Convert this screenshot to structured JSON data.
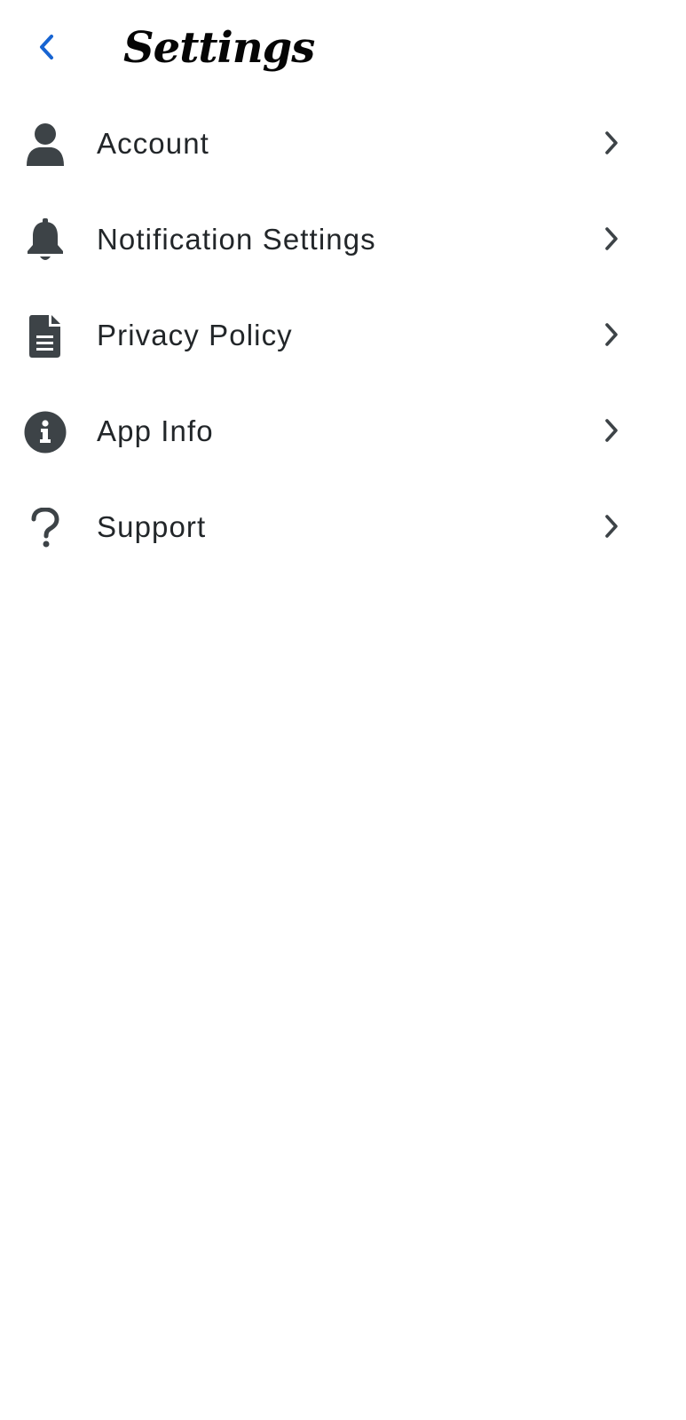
{
  "header": {
    "title": "Settings",
    "back_icon": "chevron-left-icon"
  },
  "settings": {
    "items": [
      {
        "label": "Account",
        "icon": "person-icon"
      },
      {
        "label": "Notification Settings",
        "icon": "bell-icon"
      },
      {
        "label": "Privacy Policy",
        "icon": "document-icon"
      },
      {
        "label": "App Info",
        "icon": "info-icon"
      },
      {
        "label": "Support",
        "icon": "question-icon"
      }
    ],
    "trailing_icon": "chevron-right-icon"
  },
  "colors": {
    "accent": "#1764d2",
    "icon": "#3d4347",
    "text": "#222629",
    "background": "#ffffff"
  }
}
